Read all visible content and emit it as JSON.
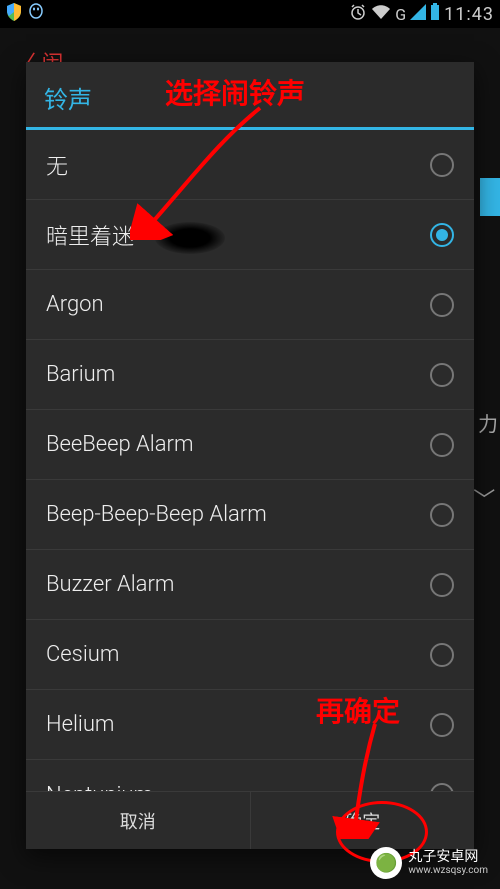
{
  "status": {
    "time": "11:43",
    "network_label": "G",
    "icons": [
      "shield",
      "qq",
      "alarm",
      "wifi",
      "signal",
      "battery"
    ]
  },
  "dialog": {
    "title": "铃声",
    "selected_index": 1,
    "items": [
      "无",
      "暗里着迷",
      "Argon",
      "Barium",
      "BeeBeep Alarm",
      "Beep-Beep-Beep Alarm",
      "Buzzer Alarm",
      "Cesium",
      "Helium",
      "Neptunium"
    ],
    "cancel_label": "取消",
    "ok_label": "确定"
  },
  "annotations": {
    "top": "选择闹铃声",
    "bottom": "再确定"
  },
  "watermark": {
    "name": "丸子安卓网",
    "url": "www.wzsqsy.com"
  }
}
